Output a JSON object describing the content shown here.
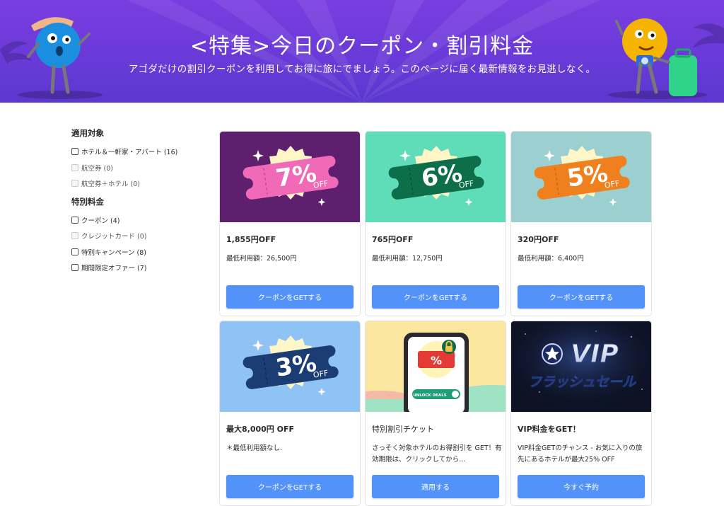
{
  "hero": {
    "title": "<特集>今日のクーポン・割引料金",
    "subtitle": "アゴダだけの割引クーポンを利用してお得に旅にでましょう。このページに届く最新情報をお見逃しなく。"
  },
  "sidebar": {
    "groups": [
      {
        "heading": "適用対象",
        "items": [
          {
            "label": "ホテル＆一軒家・アパート (16)",
            "enabled": true,
            "checked": false
          },
          {
            "label": "航空券 (0)",
            "enabled": false,
            "checked": false
          },
          {
            "label": "航空券＋ホテル (0)",
            "enabled": false,
            "checked": false
          }
        ]
      },
      {
        "heading": "特別料金",
        "items": [
          {
            "label": "クーポン (4)",
            "enabled": true,
            "checked": false
          },
          {
            "label": "クレジットカード (0)",
            "enabled": false,
            "checked": false
          },
          {
            "label": "特別キャンペーン (8)",
            "enabled": true,
            "checked": false
          },
          {
            "label": "期間限定オファー (7)",
            "enabled": true,
            "checked": false
          }
        ]
      }
    ]
  },
  "cards": [
    {
      "badge_percent": "7%",
      "badge_off": "OFF",
      "theme": {
        "bg": "#5e1f6e",
        "ticket": "#f06ab8",
        "ticket_dark": "#d94f9f"
      },
      "title": "1,855円OFF",
      "desc": "最低利用額：26,500円",
      "button": "クーポンをGETする"
    },
    {
      "badge_percent": "6%",
      "badge_off": "OFF",
      "theme": {
        "bg": "#5fdcb8",
        "ticket": "#0d6e4a",
        "ticket_dark": "#0a5a3c"
      },
      "title": "765円OFF",
      "desc": "最低利用額：12,750円",
      "button": "クーポンをGETする"
    },
    {
      "badge_percent": "5%",
      "badge_off": "OFF",
      "theme": {
        "bg": "#9ccfcf",
        "ticket": "#f07f1e",
        "ticket_dark": "#d86c12"
      },
      "title": "320円OFF",
      "desc": "最低利用額：6,400円",
      "button": "クーポンをGETする"
    },
    {
      "badge_percent": "3%",
      "badge_off": "OFF",
      "theme": {
        "bg": "#8fc3f5",
        "ticket": "#1c3d73",
        "ticket_dark": "#152f5a"
      },
      "title": "最大8,000円 OFF",
      "desc": "＊最低利用額なし.",
      "button": "クーポンをGETする"
    },
    {
      "phone_pct": "%",
      "phone_unlock": "UNLOCK DEALS",
      "title": "特別割引チケット",
      "desc": "さっそく対象ホテルのお得割引を GET！有効期限は、クリックしてから...",
      "button": "適用する"
    },
    {
      "vip_top": "VIP",
      "vip_bottom": "フラッシュセール",
      "title": "VIP料金をGET！",
      "desc": "VIP料金GETのチャンス - お気に入りの旅先にあるホテルが最大25% OFF",
      "button": "今すぐ予約"
    }
  ],
  "colors": {
    "accent": "#5392f9",
    "hero_purple": "#6a3ad8"
  },
  "icons": [
    "checkbox-icon",
    "sparkle-icon",
    "lock-icon",
    "star-icon"
  ]
}
